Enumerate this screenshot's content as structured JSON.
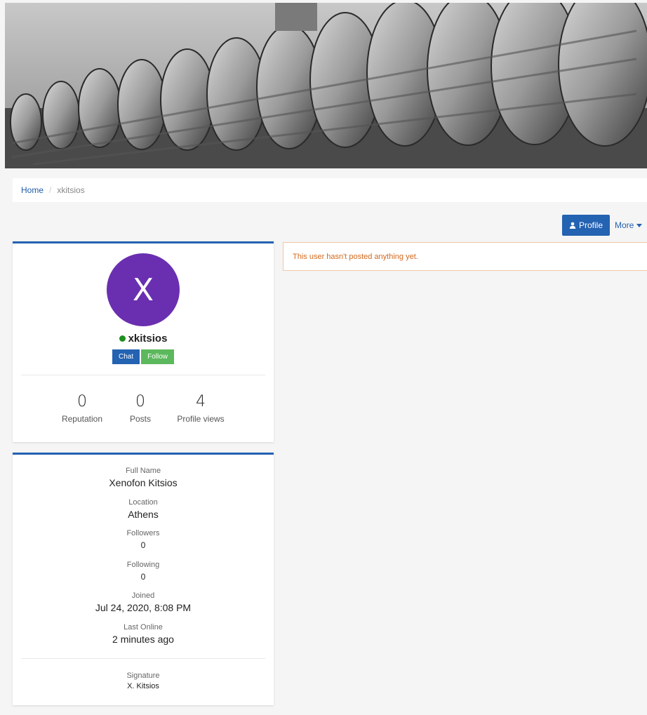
{
  "breadcrumb": {
    "home": "Home",
    "separator": "/",
    "current": "xkitsios"
  },
  "toolbar": {
    "profile_label": "Profile",
    "profile_icon": "user-icon",
    "more_label": "More",
    "more_icon": "caret-down-icon"
  },
  "user": {
    "avatar_letter": "X",
    "avatar_color": "#6a2fb0",
    "status": "online",
    "status_color": "#1f8f1f",
    "username": "xkitsios",
    "chat_label": "Chat",
    "follow_label": "Follow"
  },
  "stats": [
    {
      "value": "0",
      "label": "Reputation"
    },
    {
      "value": "0",
      "label": "Posts"
    },
    {
      "value": "4",
      "label": "Profile views"
    }
  ],
  "info": [
    {
      "label": "Full Name",
      "value": "Xenofon Kitsios"
    },
    {
      "label": "Location",
      "value": "Athens"
    },
    {
      "label": "Followers",
      "value": "0"
    },
    {
      "label": "Following",
      "value": "0"
    },
    {
      "label": "Joined",
      "value": "Jul 24, 2020, 8:08 PM"
    },
    {
      "label": "Last Online",
      "value": "2 minutes ago"
    }
  ],
  "signature": {
    "label": "Signature",
    "value": "X. Kitsios"
  },
  "alert": {
    "message": "This user hasn't posted anything yet."
  },
  "colors": {
    "accent": "#2462b2",
    "follow": "#5cb85c",
    "alert_text": "#d2691e"
  }
}
